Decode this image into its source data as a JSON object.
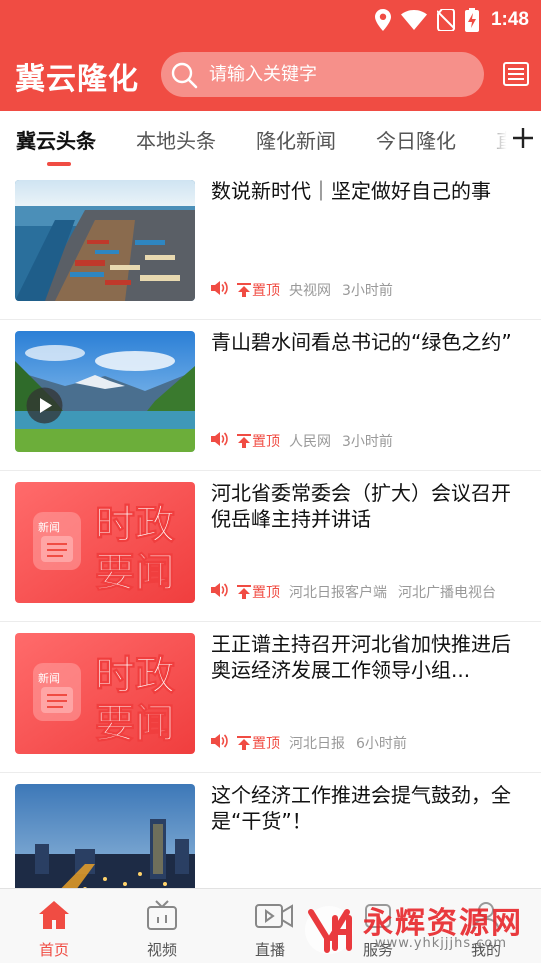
{
  "status_bar": {
    "time": "1:48",
    "icons": [
      "location-icon",
      "wifi-icon",
      "no-sim-icon",
      "battery-charging-icon"
    ]
  },
  "header": {
    "title": "冀云隆化",
    "search": {
      "placeholder": "请输入关键字",
      "icon": "search-icon"
    },
    "menu_icon": "newspaper-menu-icon"
  },
  "tabs": [
    {
      "label": "冀云头条",
      "active": true
    },
    {
      "label": "本地头条",
      "active": false
    },
    {
      "label": "隆化新闻",
      "active": false
    },
    {
      "label": "今日隆化",
      "active": false
    },
    {
      "label": "直",
      "active": false
    }
  ],
  "tab_more_icon": "plus-icon",
  "news": [
    {
      "title": "数说新时代｜坚定做好自己的事",
      "pin_label": "置顶",
      "source": "央视网",
      "time": "3小时前",
      "thumb": "container-port-aerial"
    },
    {
      "title": "青山碧水间看总书记的“绿色之约”",
      "pin_label": "置顶",
      "source": "人民网",
      "time": "3小时前",
      "thumb": "mountain-lake"
    },
    {
      "title": "河北省委常委会（扩大）会议召开 倪岳峰主持并讲话",
      "pin_label": "置顶",
      "source": "河北日报客户端",
      "time": "河北广播电视台",
      "thumb": "politics-news-banner",
      "badge_text": "新闻",
      "banner_text_1": "时政",
      "banner_text_2": "要闻",
      "has_video": true
    },
    {
      "title": "王正谱主持召开河北省加快推进后奥运经济发展工作领导小组...",
      "pin_label": "置顶",
      "source": "河北日报",
      "time": "6小时前",
      "thumb": "politics-news-banner",
      "badge_text": "新闻",
      "banner_text_1": "时政",
      "banner_text_2": "要闻"
    },
    {
      "title": "这个经济工作推进会提气鼓劲，全是“干货”！",
      "thumb": "city-night-skyline"
    }
  ],
  "bottom_nav": [
    {
      "label": "首页",
      "icon": "home-icon",
      "active": true
    },
    {
      "label": "视频",
      "icon": "tv-icon",
      "active": false
    },
    {
      "label": "直播",
      "icon": "video-camera-icon",
      "active": false
    },
    {
      "label": "服务",
      "icon": "service-icon",
      "active": false
    },
    {
      "label": "我的",
      "icon": "user-icon",
      "active": false
    }
  ],
  "watermark": {
    "text": "永辉资源网",
    "url": "www.yhkjjjhs.com"
  },
  "colors": {
    "brand_red": "#f04c43",
    "search_bg": "#f6908a",
    "meta_gray": "#999999"
  }
}
